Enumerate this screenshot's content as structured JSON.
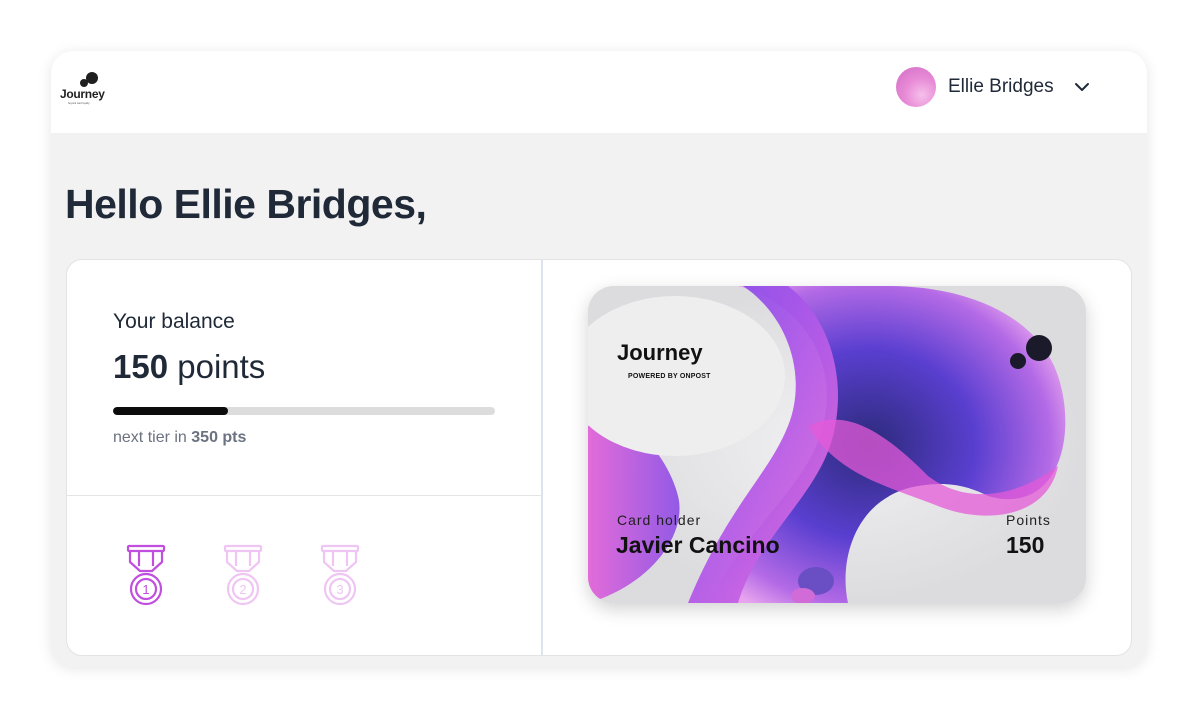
{
  "app": {
    "logo_text": "Journey",
    "logo_tagline": "beyond card loyalty"
  },
  "header": {
    "user_name": "Ellie Bridges",
    "avatar_icon": "avatar",
    "menu_icon": "chevron-down-icon"
  },
  "greeting": "Hello Ellie Bridges,",
  "balance": {
    "label": "Your balance",
    "amount": "150",
    "unit": "points",
    "progress_fraction": 0.3,
    "next_tier_prefix": "next tier in",
    "next_tier_value": "350 pts"
  },
  "medals": [
    {
      "number": "1",
      "state": "active"
    },
    {
      "number": "2",
      "state": "locked"
    },
    {
      "number": "3",
      "state": "locked"
    }
  ],
  "card": {
    "brand": "Journey",
    "powered_by": "POWERED BY ONPOST",
    "holder_label": "Card holder",
    "holder_name": "Javier Cancino",
    "points_label": "Points",
    "points_value": "150"
  },
  "colors": {
    "medal_active": "#c04fe0",
    "medal_locked": "#efc6f3",
    "progress_fill": "#0c0c0c",
    "progress_track": "#dcdcdc"
  }
}
